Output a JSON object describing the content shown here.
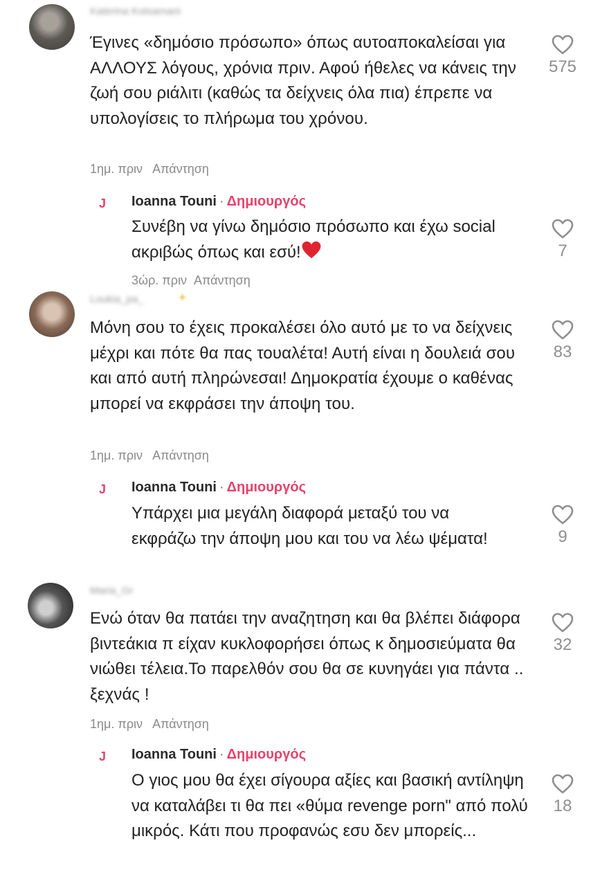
{
  "comments": [
    {
      "username": "Katerina Kotsamani",
      "text": "Έγινες «δημόσιο πρόσωπο» όπως αυτοαποκαλείσαι για ΑΛΛΟΥΣ λόγους, χρόνια πριν. Αφού ήθελες να κάνεις την ζωή σου ριάλιτι (καθώς τα δείχνεις όλα πια) έπρεπε να υπολογίσεις το πλήρωμα του χρόνου.",
      "time": "1ημ. πριν",
      "reply_label": "Απάντηση",
      "likes": "575",
      "reply": {
        "avatar_letter": "J",
        "name": "Ioanna Touni",
        "separator": "·",
        "badge": "Δημιουργός",
        "text": "Συνέβη να γίνω δημόσιο πρόσωπο και έχω social ακριβώς όπως και εσύ!",
        "emoji": "red-heart-emoji",
        "time": "3ώρ. πριν",
        "reply_label": "Απάντηση",
        "likes": "7"
      }
    },
    {
      "username": "Loukia_pa_",
      "text": "Μόνη σου το έχεις προκαλέσει όλο αυτό με το να δείχνεις μέχρι και πότε θα πας τουαλέτα! Αυτή είναι η δουλειά σου και από αυτή πληρώνεσαι! Δημοκρατία έχουμε ο καθένας μπορεί να εκφράσει την άποψη του.",
      "time": "1ημ. πριν",
      "reply_label": "Απάντηση",
      "likes": "83",
      "reply": {
        "avatar_letter": "J",
        "name": "Ioanna Touni",
        "separator": "·",
        "badge": "Δημιουργός",
        "text": "Υπάρχει μια μεγάλη διαφορά μεταξύ του να εκφράζω την άποψη μου και του να λέω ψέματα!",
        "likes": "9"
      }
    },
    {
      "username": "Maria_Gr",
      "text": "Ενώ όταν θα πατάει την αναζητηση και θα βλέπει διάφορα βιντεάκια π είχαν κυκλοφορήσει όπως κ δημοσιεύματα θα νιώθει τέλεια.Το παρελθόν σου θα σε κυνηγάει για πάντα .. ξεχνάς !",
      "time": "1ημ. πριν",
      "reply_label": "Απάντηση",
      "likes": "32",
      "reply": {
        "avatar_letter": "J",
        "name": "Ioanna Touni",
        "separator": "·",
        "badge": "Δημιουργός",
        "text": "Ο γιος μου θα έχει σίγουρα αξίες και βασική αντίληψη να καταλάβει τι θα πει «θύμα revenge porn\" από πολύ μικρός. Κάτι που προφανώς εσυ δεν μπορείς...",
        "likes": "18"
      }
    }
  ],
  "colors": {
    "creator_badge": "#e5436b",
    "meta_text": "#8a8a8a",
    "like_icon": "#8e8e8e",
    "emoji_heart": "#e0242f"
  },
  "icons": {
    "like": "heart-outline-icon"
  }
}
